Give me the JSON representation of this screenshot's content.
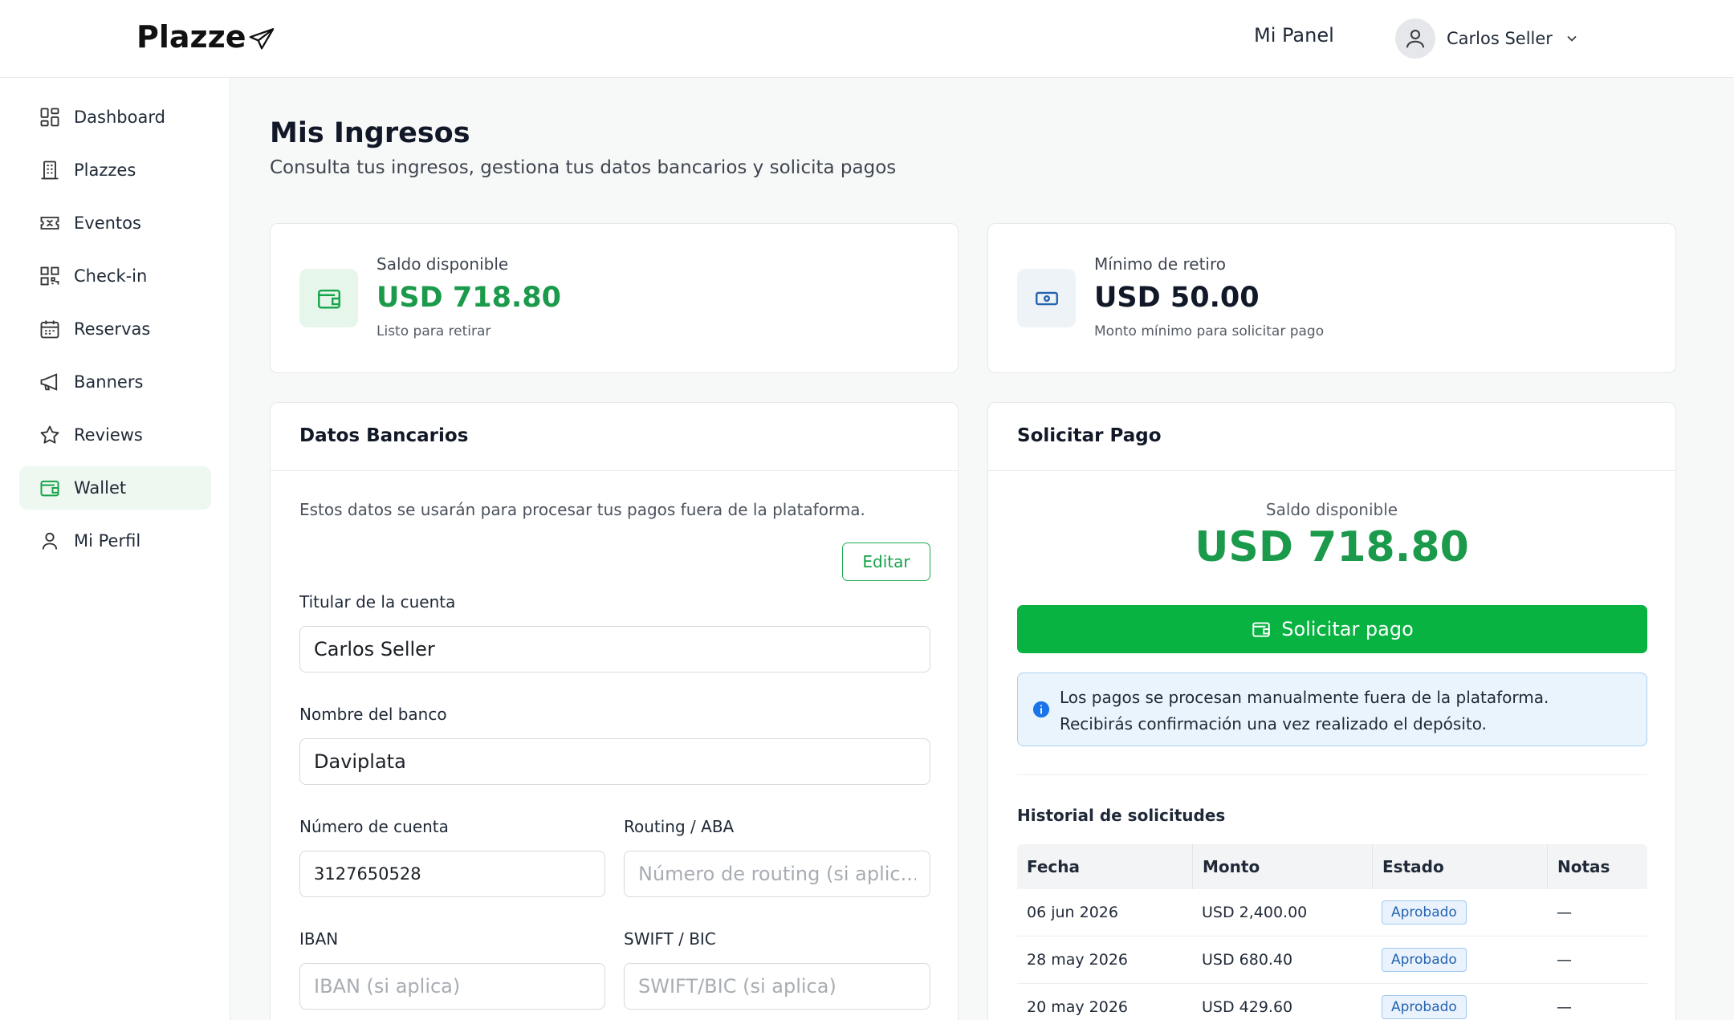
{
  "brand": {
    "name": "Plazze",
    "icon": "paper-plane-icon"
  },
  "header": {
    "panel_link": "Mi Panel",
    "user_name": "Carlos Seller"
  },
  "sidebar": {
    "items": [
      {
        "label": "Dashboard",
        "icon": "grid-icon"
      },
      {
        "label": "Plazzes",
        "icon": "building-icon"
      },
      {
        "label": "Eventos",
        "icon": "ticket-icon"
      },
      {
        "label": "Check-in",
        "icon": "qr-icon"
      },
      {
        "label": "Reservas",
        "icon": "calendar-icon"
      },
      {
        "label": "Banners",
        "icon": "megaphone-icon"
      },
      {
        "label": "Reviews",
        "icon": "star-icon"
      },
      {
        "label": "Wallet",
        "icon": "wallet-icon",
        "active": true
      },
      {
        "label": "Mi Perfil",
        "icon": "user-icon"
      }
    ]
  },
  "page": {
    "title": "Mis Ingresos",
    "subtitle": "Consulta tus ingresos, gestiona tus datos bancarios y solicita pagos"
  },
  "stats": {
    "available": {
      "label": "Saldo disponible",
      "value": "USD 718.80",
      "note": "Listo para retirar"
    },
    "minimum": {
      "label": "Mínimo de retiro",
      "value": "USD 50.00",
      "note": "Monto mínimo para solicitar pago"
    }
  },
  "bank": {
    "title": "Datos Bancarios",
    "description": "Estos datos se usarán para procesar tus pagos fuera de la plataforma.",
    "edit_label": "Editar",
    "holder_label": "Titular de la cuenta",
    "holder_value": "Carlos Seller",
    "bank_label": "Nombre del banco",
    "bank_value": "Daviplata",
    "account_label": "Número de cuenta",
    "account_value": "3127650528",
    "routing_label": "Routing / ABA",
    "routing_placeholder": "Número de routing (si aplic...",
    "iban_label": "IBAN",
    "iban_placeholder": "IBAN (si aplica)",
    "swift_label": "SWIFT / BIC",
    "swift_placeholder": "SWIFT/BIC (si aplica)"
  },
  "payment": {
    "title": "Solicitar Pago",
    "balance_label": "Saldo disponible",
    "balance_value": "USD 718.80",
    "button_label": "Solicitar pago",
    "info_line1": "Los pagos se procesan manualmente fuera de la plataforma.",
    "info_line2": "Recibirás confirmación una vez realizado el depósito.",
    "history_title": "Historial de solicitudes",
    "columns": [
      "Fecha",
      "Monto",
      "Estado",
      "Notas"
    ],
    "rows": [
      {
        "date": "06 jun 2026",
        "amount": "USD 2,400.00",
        "status": "Aprobado",
        "notes": "—"
      },
      {
        "date": "28 may 2026",
        "amount": "USD 680.40",
        "status": "Aprobado",
        "notes": "—"
      },
      {
        "date": "20 may 2026",
        "amount": "USD 429.60",
        "status": "Aprobado",
        "notes": "—"
      }
    ]
  },
  "colors": {
    "accent_green": "#08b341",
    "value_green": "#1a9a4a",
    "info_blue": "#1a73e8"
  }
}
